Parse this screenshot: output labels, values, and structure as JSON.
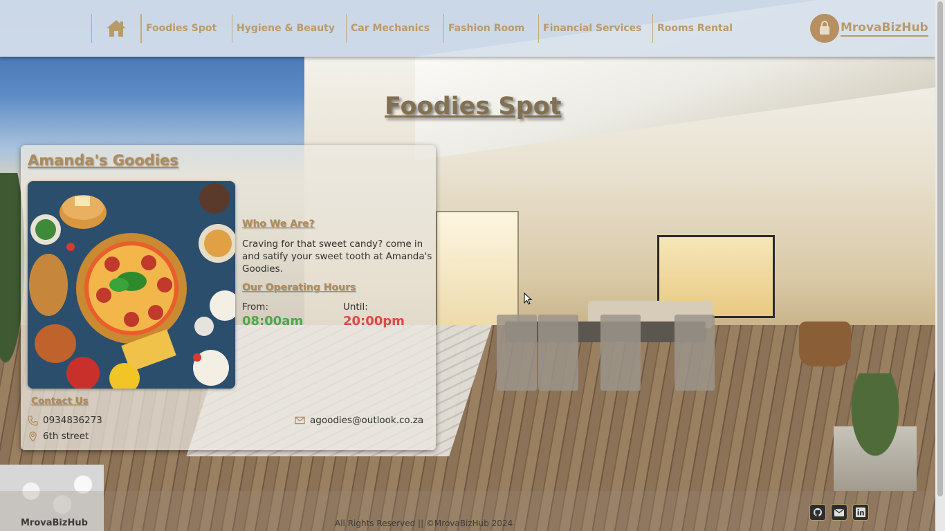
{
  "nav": {
    "home_icon": "home-icon",
    "items": [
      {
        "label": "Foodies Spot"
      },
      {
        "label": "Hygiene & Beauty"
      },
      {
        "label": "Car Mechanics"
      },
      {
        "label": "Fashion Room"
      },
      {
        "label": "Financial Services"
      },
      {
        "label": "Rooms Rental"
      }
    ],
    "brand": {
      "name": "MrovaBizHub",
      "logo_icon": "shopping-bag-icon"
    }
  },
  "page": {
    "title": "Foodies Spot"
  },
  "business": {
    "name": "Amanda's Goodies",
    "image_icon": "food-platter-image",
    "about_title": "Who We Are?",
    "about_text": "Craving for that sweet candy? come in and satify your sweet tooth at Amanda's Goodies.",
    "hours_title": "Our Operating Hours",
    "from_label": "From:",
    "from_time": "08:00am",
    "until_label": "Until:",
    "until_time": "20:00pm",
    "contact_title": "Contact Us",
    "phone": "0934836273",
    "email": "agoodies@outlook.co.za",
    "address": "6th street"
  },
  "footer": {
    "brand": "MrovaBizHub",
    "copyright": "All Rights Reserved || ©MrovaBizHub 2024",
    "social": [
      "github-icon",
      "mail-icon",
      "linkedin-icon"
    ]
  },
  "colors": {
    "accent": "#b89a6a",
    "from_time": "#4fa64a",
    "until_time": "#e04848",
    "navbar_bg": "#d7e1ec"
  }
}
